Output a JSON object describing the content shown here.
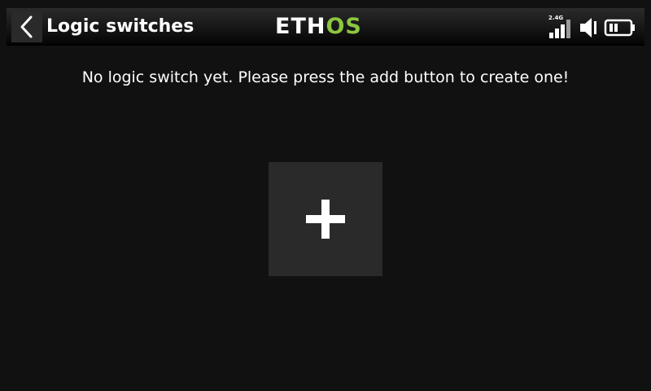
{
  "header": {
    "title": "Logic switches",
    "back_icon": "chevron-left-icon",
    "logo": {
      "part1": "ETH",
      "part2": "OS"
    },
    "status": {
      "signal_band": "2.4G",
      "signal_icon": "signal-bars-icon",
      "volume_icon": "speaker-icon",
      "battery_icon": "battery-icon"
    }
  },
  "main": {
    "empty_message": "No logic switch yet. Please press the add button to create one!",
    "add_icon": "plus-icon"
  },
  "colors": {
    "background": "#111111",
    "button": "#2a2a2a",
    "text": "#ffffff",
    "brand_green": "#8dc63f"
  }
}
